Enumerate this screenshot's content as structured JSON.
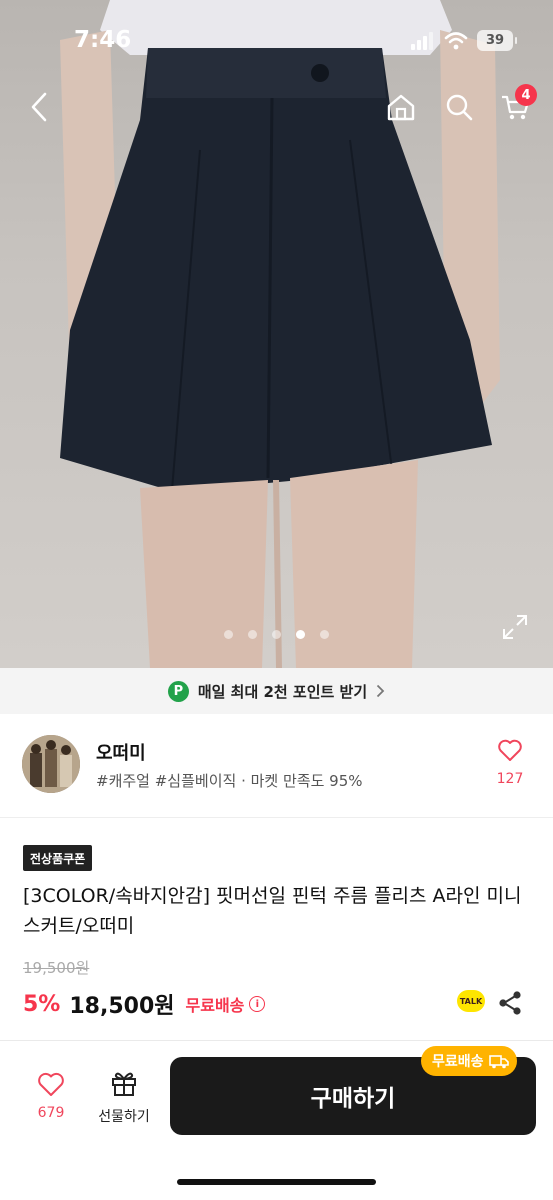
{
  "status_bar": {
    "time": "7:46",
    "battery": "39"
  },
  "nav": {
    "cart_count": "4"
  },
  "gallery": {
    "page_count": 5,
    "active_index": 3
  },
  "point_banner": {
    "icon_letter": "P",
    "text": "매일 최대 2천 포인트 받기"
  },
  "shop": {
    "name": "오떠미",
    "tags": "#캐주얼 #심플베이직 · 마켓 만족도 95%",
    "like_count": "127"
  },
  "product": {
    "coupon_badge": "전상품쿠폰",
    "title": "[3COLOR/속바지안감] 핏머선일 핀턱 주름 플리츠 A라인 미니스커트/오떠미",
    "original_price": "19,500원",
    "discount": "5%",
    "price": "18,500원",
    "shipping": "무료배송",
    "talk_label": "TALK"
  },
  "bottom_bar": {
    "like_count": "679",
    "gift_label": "선물하기",
    "buy_label": "구매하기",
    "ship_tag": "무료배송"
  },
  "colors": {
    "accent_red": "#f6354c",
    "ship_yellow": "#ffb300",
    "button_dark": "#1a1a1a",
    "point_green": "#22a24a"
  }
}
